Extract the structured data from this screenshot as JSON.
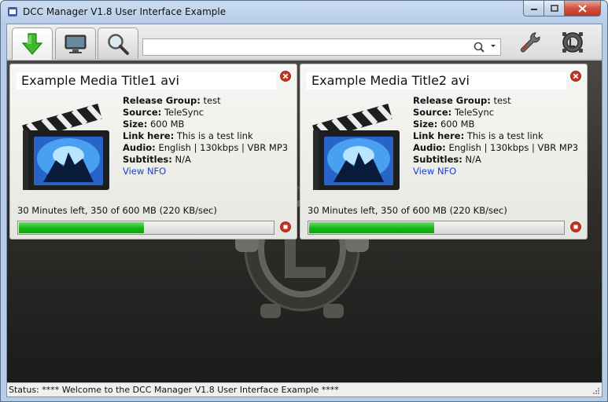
{
  "window": {
    "title": "DCC Manager V1.8 User Interface Example"
  },
  "toolbar": {
    "tabs": [
      {
        "name": "downloads",
        "icon": "download-arrow-icon",
        "active": true
      },
      {
        "name": "monitor",
        "icon": "monitor-icon",
        "active": false
      },
      {
        "name": "search",
        "icon": "magnifier-icon",
        "active": false
      }
    ],
    "search": {
      "value": "",
      "placeholder": ""
    },
    "settings_icon": "wrench-icon",
    "about_icon": "logo-gear-icon"
  },
  "downloads": [
    {
      "title": "Example Media Title1 avi",
      "release_group_label": "Release Group",
      "release_group": "test",
      "source_label": "Source",
      "source": "TeleSync",
      "size_label": "Size",
      "size": "600 MB",
      "link_label": "Link here",
      "link": "This is a test link",
      "audio_label": "Audio",
      "audio": "English | 130kbps | VBR MP3",
      "subtitles_label": "Subtitles",
      "subtitles": "N/A",
      "nfo_link": "View NFO",
      "progress_text": "30 Minutes left, 350 of 600 MB (220 KB/sec)",
      "progress_fraction": 0.4928
    },
    {
      "title": "Example Media Title2 avi",
      "release_group_label": "Release Group",
      "release_group": "test",
      "source_label": "Source",
      "source": "TeleSync",
      "size_label": "Size",
      "size": "600 MB",
      "link_label": "Link here",
      "link": "This is a test link",
      "audio_label": "Audio",
      "audio": "English | 130kbps | VBR MP3",
      "subtitles_label": "Subtitles",
      "subtitles": "N/A",
      "nfo_link": "View NFO",
      "progress_text": "30 Minutes left, 350 of 600 MB (220 KB/sec)",
      "progress_fraction": 0.4928
    }
  ],
  "status": {
    "text": "Status: **** Welcome to the DCC Manager V1.8 User Interface Example ****"
  },
  "colors": {
    "progress_green": "#19b518",
    "link_blue": "#1a3fd6",
    "close_red": "#c8321e"
  }
}
